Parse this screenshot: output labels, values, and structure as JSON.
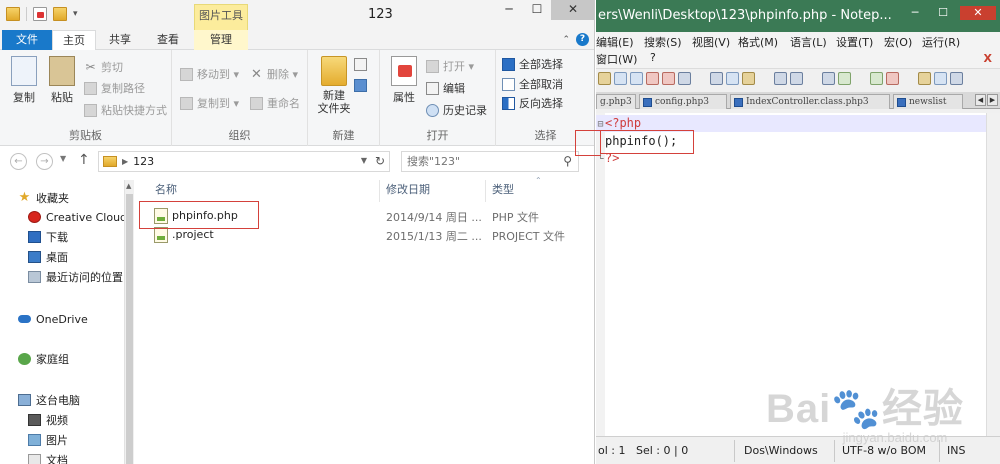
{
  "explorer": {
    "title": "123",
    "quick_access_arrow": "▾",
    "picture_tools_label": "图片工具",
    "tabs": {
      "file": "文件",
      "home": "主页",
      "share": "共享",
      "view": "查看",
      "manage": "管理"
    },
    "ribbon": {
      "clipboard": {
        "copy": "复制",
        "paste": "粘贴",
        "cut": "剪切",
        "copy_path": "复制路径",
        "paste_shortcut": "粘贴快捷方式",
        "label": "剪贴板"
      },
      "organize": {
        "move_to": "移动到 ▾",
        "copy_to": "复制到 ▾",
        "delete": "删除 ▾",
        "rename": "重命名",
        "label": "组织"
      },
      "new": {
        "new_folder": "新建\n文件夹",
        "label": "新建"
      },
      "open": {
        "properties": "属性",
        "open": "打开 ▾",
        "edit": "编辑",
        "history": "历史记录",
        "label": "打开"
      },
      "select": {
        "select_all": "全部选择",
        "select_none": "全部取消",
        "invert": "反向选择",
        "label": "选择"
      }
    },
    "address": {
      "path": "123"
    },
    "search": {
      "placeholder": "搜索\"123\""
    },
    "nav": {
      "favorites": "收藏夹",
      "creative_cloud": "Creative Cloud",
      "downloads": "下载",
      "desktop": "桌面",
      "recent": "最近访问的位置",
      "onedrive": "OneDrive",
      "homegroup": "家庭组",
      "this_pc": "这台电脑",
      "videos": "视频",
      "pictures": "图片",
      "documents": "文档"
    },
    "columns": {
      "name": "名称",
      "modified": "修改日期",
      "type": "类型"
    },
    "files": [
      {
        "name": "phpinfo.php",
        "modified": "2014/9/14 周日 ...",
        "type": "PHP 文件"
      },
      {
        "name": ".project",
        "modified": "2015/1/13 周二 ...",
        "type": "PROJECT 文件"
      }
    ]
  },
  "notepad": {
    "title": "ers\\Wenli\\Desktop\\123\\phpinfo.php - Notep...",
    "menu_row1": [
      "编辑(E)",
      "搜索(S)",
      "视图(V)",
      "格式(M)",
      "语言(L)",
      "设置(T)",
      "宏(O)",
      "运行(R)"
    ],
    "menu_row2": [
      "窗口(W)",
      "?"
    ],
    "menu_close": "X",
    "tabs": [
      "g.php3",
      "config.php3",
      "IndexController.class.php3",
      "newslist"
    ],
    "code": {
      "line1": "<?php",
      "line2_fn": "phpinfo",
      "line2_rest": "();",
      "line3": "?>"
    },
    "status": {
      "pos": "ol : 1",
      "sel": "Sel : 0 | 0",
      "eol": "Dos\\Windows",
      "encoding": "UTF-8 w/o BOM",
      "mode": "INS"
    }
  },
  "watermark": {
    "main": "Bai🐾经验",
    "sub": "jingyan.baidu.com"
  }
}
